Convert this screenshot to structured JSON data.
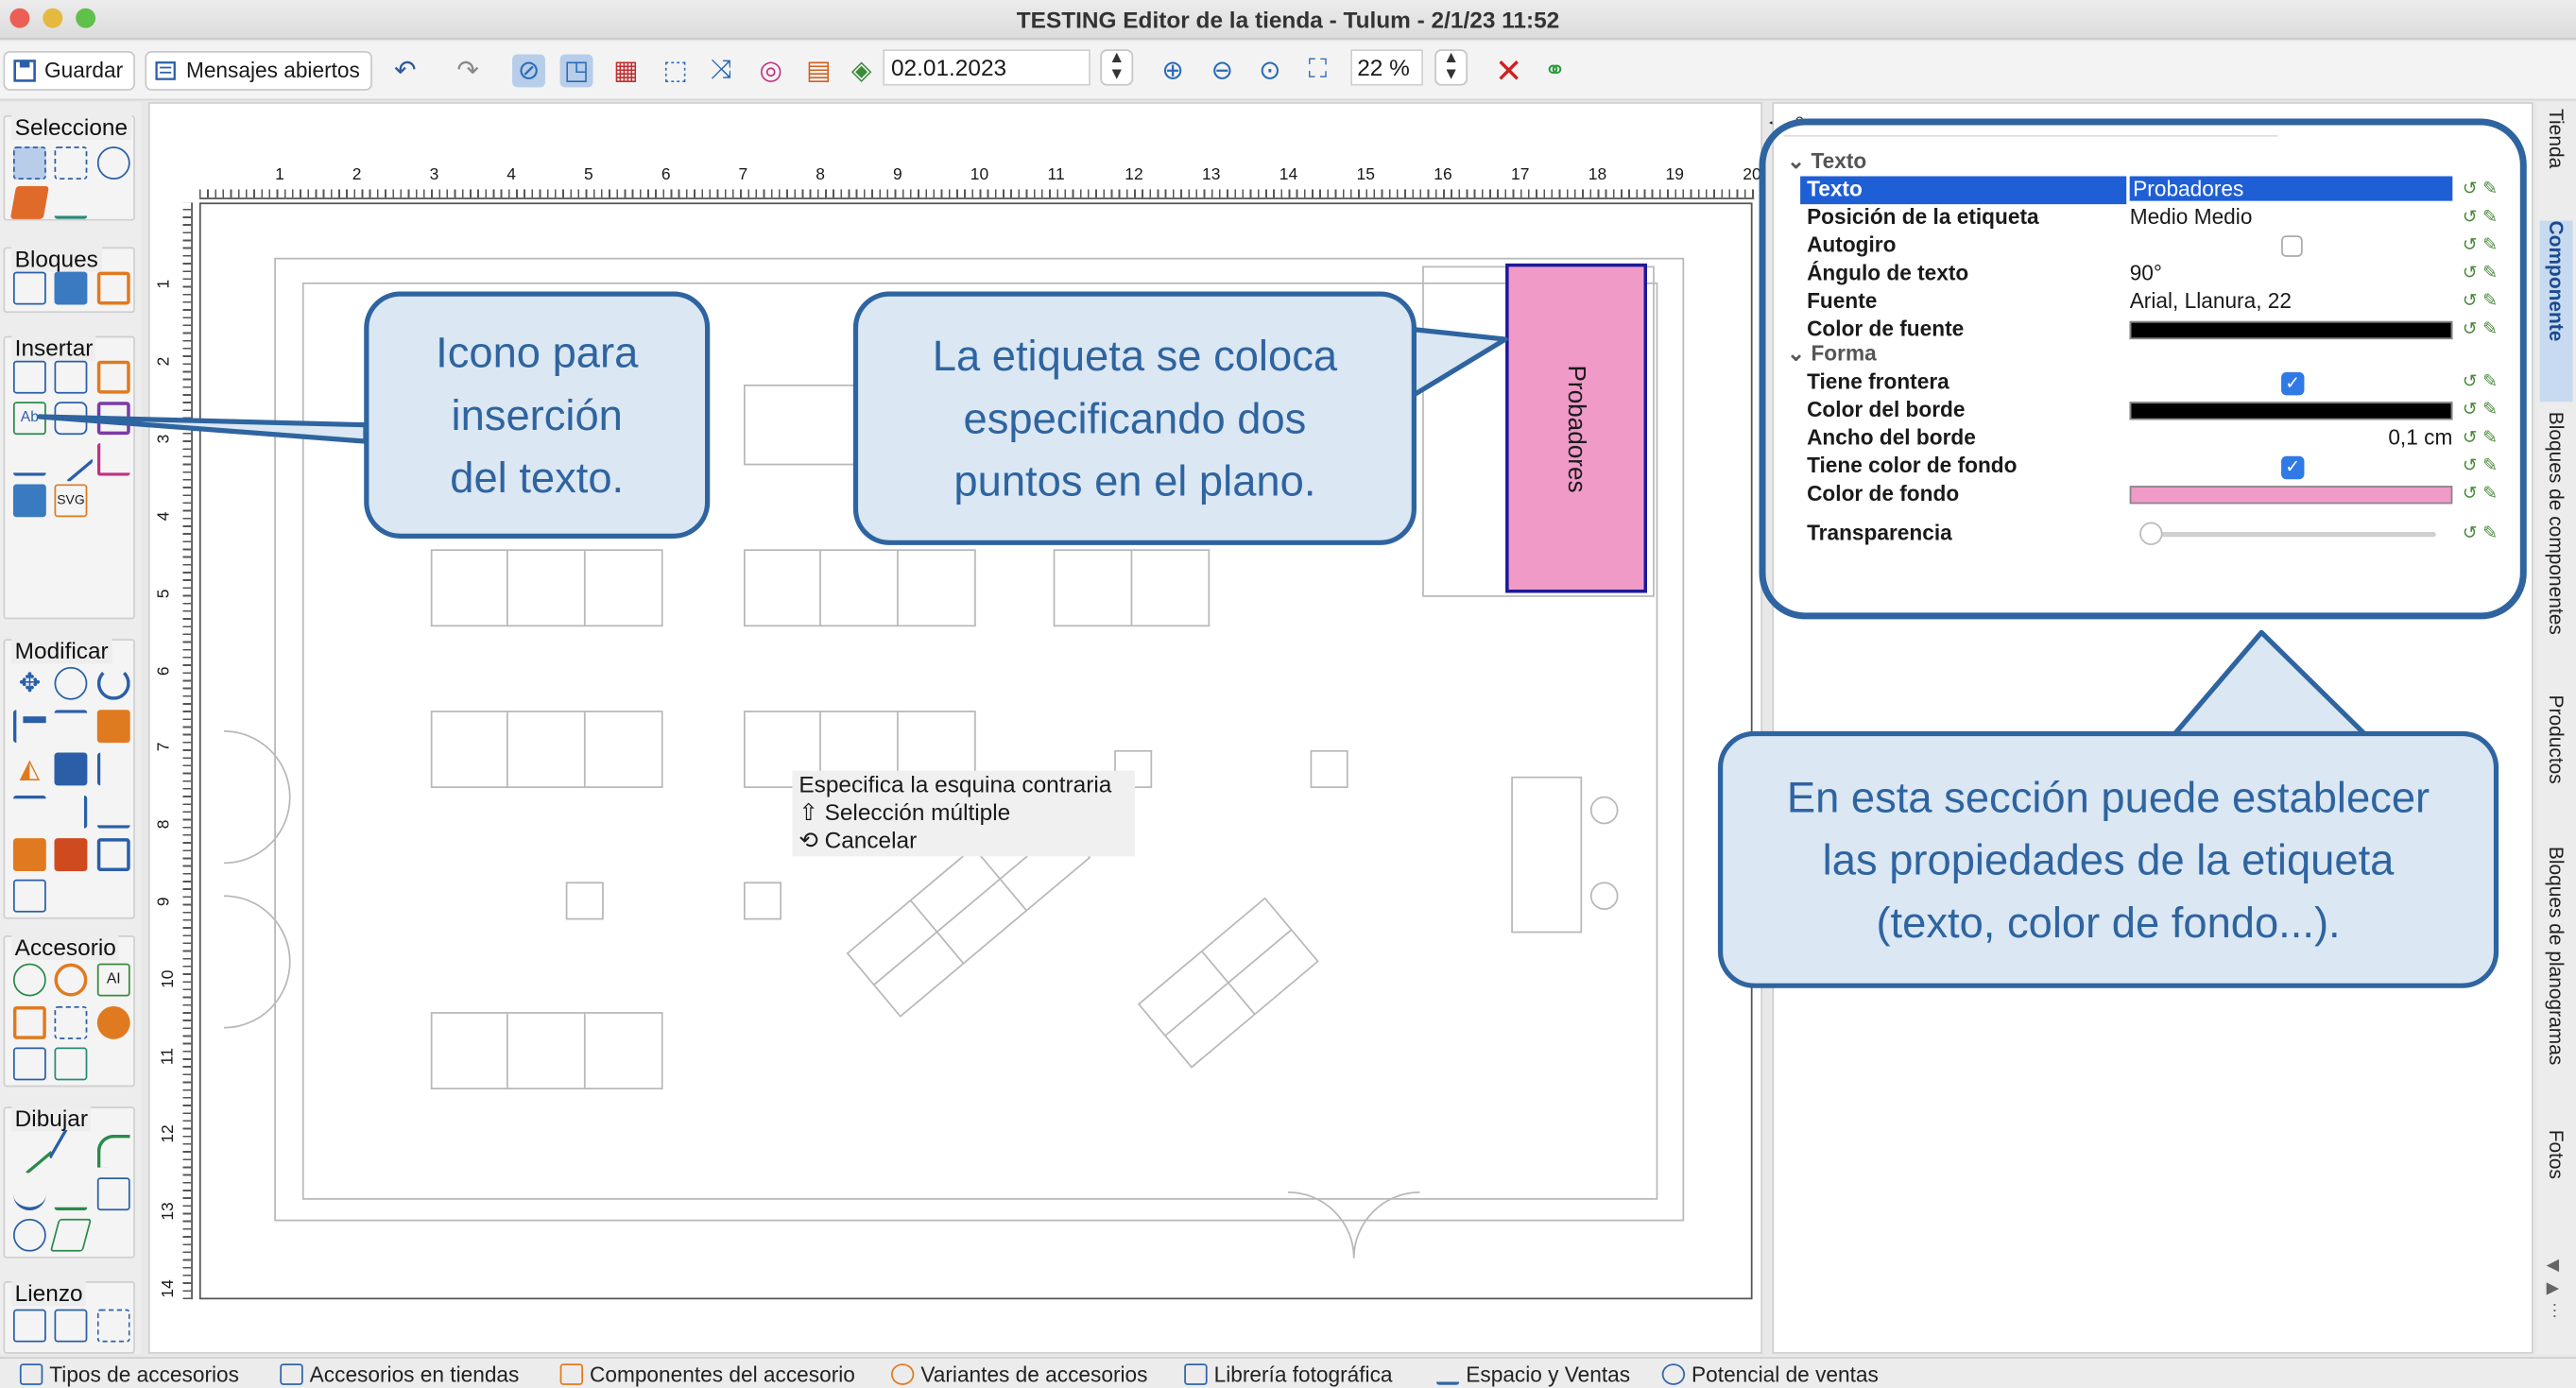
{
  "window": {
    "title": "TESTING Editor de la tienda - Tulum - 2/1/23 11:52"
  },
  "toolbar": {
    "save_label": "Guardar",
    "messages_label": "Mensajes abiertos",
    "date_value": "02.01.2023",
    "zoom_value": "22 %"
  },
  "left_panel": {
    "sections": [
      "Seleccione",
      "Bloques",
      "Insertar",
      "Modificar",
      "Accesorio",
      "Dibujar",
      "Lienzo"
    ]
  },
  "canvas": {
    "ruler_h": [
      "1",
      "2",
      "3",
      "4",
      "5",
      "6",
      "7",
      "8",
      "9",
      "10",
      "11",
      "12",
      "13",
      "14",
      "15",
      "16",
      "17",
      "18",
      "19",
      "20"
    ],
    "ruler_v": [
      "1",
      "2",
      "3",
      "4",
      "5",
      "6",
      "7",
      "8",
      "9",
      "10",
      "11",
      "12",
      "13",
      "14"
    ],
    "label_text": "Probadores",
    "label_color": "#f09ac8",
    "context_menu": [
      "Especifica la esquina contraria",
      "⇧ Selección múltiple",
      "⟲ Cancelar"
    ]
  },
  "properties": {
    "section_texto": "Texto",
    "section_forma": "Forma",
    "rows": [
      {
        "key": "Texto",
        "value": "Probadores"
      },
      {
        "key": "Posición de la etiqueta",
        "value": "Medio Medio"
      },
      {
        "key": "Autogiro",
        "value": ""
      },
      {
        "key": "Ángulo de texto",
        "value": "90°"
      },
      {
        "key": "Fuente",
        "value": "Arial, Llanura, 22"
      },
      {
        "key": "Color de fuente",
        "value": ""
      },
      {
        "key": "Tiene frontera",
        "value": ""
      },
      {
        "key": "Color del borde",
        "value": ""
      },
      {
        "key": "Ancho del borde",
        "value": "0,1 cm"
      },
      {
        "key": "Tiene color de fondo",
        "value": ""
      },
      {
        "key": "Color de fondo",
        "value": ""
      },
      {
        "key": "Transparencia",
        "value": ""
      }
    ],
    "colors": {
      "font": "#000000",
      "border": "#000000",
      "background": "#f09ac8",
      "selected_row": "#1f5fd6"
    }
  },
  "sidebar_tabs": [
    "Tienda",
    "Componente",
    "Bloques de componentes",
    "Productos",
    "Bloques de planogramas",
    "Fotos"
  ],
  "bottom_tabs": [
    "Tipos de accesorios",
    "Accesorios en tiendas",
    "Componentes del accesorio",
    "Variantes de accesorios",
    "Librería fotográfica",
    "Espacio y Ventas",
    "Potencial de ventas"
  ],
  "callouts": {
    "icon": "Icono para inserción del texto.",
    "label": "La etiqueta se coloca especificando dos puntos en el plano.",
    "section": "En esta sección puede establecer las propiedades de la etiqueta (texto, color de fondo...)."
  }
}
